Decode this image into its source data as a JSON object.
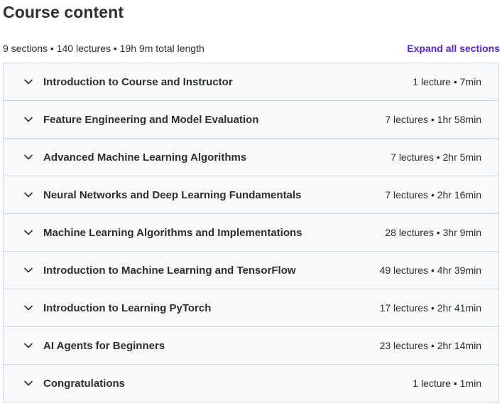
{
  "header": {
    "title": "Course content",
    "summary": "9 sections • 140 lectures • 19h 9m total length",
    "expand_label": "Expand all sections"
  },
  "colors": {
    "accent": "#5624d0",
    "section_bg": "#f7f9fa",
    "border": "#d1d7dc",
    "text": "#2d2f31"
  },
  "sections": [
    {
      "title": "Introduction to Course and Instructor",
      "meta": "1 lecture • 7min",
      "icon": "chevron-down-icon"
    },
    {
      "title": "Feature Engineering and Model Evaluation",
      "meta": "7 lectures • 1hr 58min",
      "icon": "chevron-down-icon"
    },
    {
      "title": "Advanced Machine Learning Algorithms",
      "meta": "7 lectures • 2hr 5min",
      "icon": "chevron-down-icon"
    },
    {
      "title": "Neural Networks and Deep Learning Fundamentals",
      "meta": "7 lectures • 2hr 16min",
      "icon": "chevron-down-icon"
    },
    {
      "title": "Machine Learning Algorithms and Implementations",
      "meta": "28 lectures • 3hr 9min",
      "icon": "chevron-down-icon"
    },
    {
      "title": "Introduction to Machine Learning and TensorFlow",
      "meta": "49 lectures • 4hr 39min",
      "icon": "chevron-down-icon"
    },
    {
      "title": "Introduction to Learning PyTorch",
      "meta": "17 lectures • 2hr 41min",
      "icon": "chevron-down-icon"
    },
    {
      "title": "AI Agents for Beginners",
      "meta": "23 lectures • 2hr 14min",
      "icon": "chevron-down-icon"
    },
    {
      "title": "Congratulations",
      "meta": "1 lecture • 1min",
      "icon": "chevron-down-icon"
    }
  ]
}
